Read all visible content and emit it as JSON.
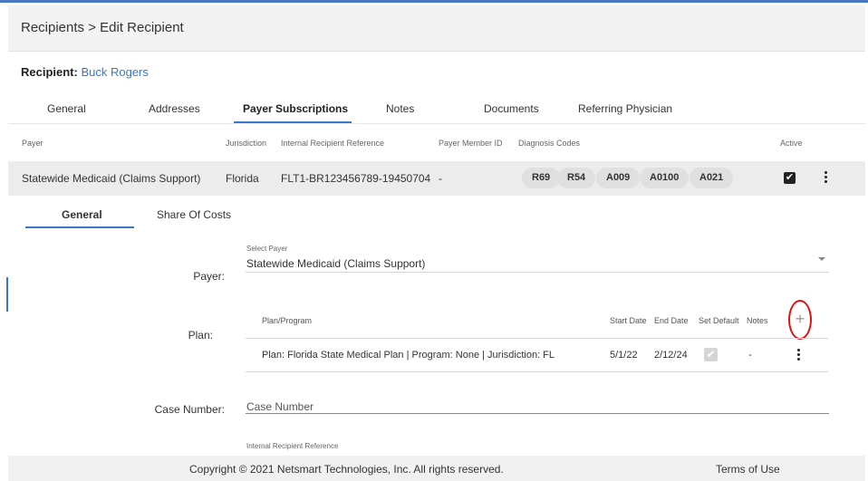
{
  "header": {
    "breadcrumb_root": "Recipients",
    "separator": ">",
    "breadcrumb_current": "Edit Recipient"
  },
  "recipient": {
    "label": "Recipient:",
    "name": "Buck Rogers"
  },
  "tabs": [
    {
      "label": "General"
    },
    {
      "label": "Addresses"
    },
    {
      "label": "Payer Subscriptions"
    },
    {
      "label": "Notes"
    },
    {
      "label": "Documents"
    },
    {
      "label": "Referring Physician"
    }
  ],
  "active_tab": "Payer Subscriptions",
  "table": {
    "columns": {
      "payer": "Payer",
      "jurisdiction": "Jurisdiction",
      "internal_ref": "Internal Recipient Reference",
      "member_id": "Payer Member ID",
      "diagnosis": "Diagnosis Codes",
      "active": "Active"
    },
    "row": {
      "payer": "Statewide Medicaid (Claims Support)",
      "jurisdiction": "Florida",
      "internal_ref": "FLT1-BR123456789-19450704",
      "member_id": "-",
      "diagnosis_codes": [
        "R69",
        "R54",
        "A009",
        "A0100",
        "A021"
      ],
      "active_check": "✔"
    }
  },
  "subtabs": [
    {
      "label": "General"
    },
    {
      "label": "Share Of Costs"
    }
  ],
  "form": {
    "payer_label": "Payer:",
    "select_payer_caption": "Select Payer",
    "payer_value": "Statewide Medicaid (Claims Support)",
    "plan_label": "Plan:",
    "plan_headers": {
      "program": "Plan/Program",
      "start": "Start Date",
      "end": "End Date",
      "set_default": "Set Default",
      "notes": "Notes"
    },
    "plan_row": {
      "program": "Plan: Florida State Medical Plan | Program: None | Jurisdiction: FL",
      "start": "5/1/22",
      "end": "2/12/24",
      "set_default_check": "✔",
      "notes": "-"
    },
    "add_symbol": "+",
    "case_label": "Case Number:",
    "case_placeholder": "Case Number",
    "internal_ref_caption": "Internal Recipient Reference"
  },
  "footer": {
    "copyright": "Copyright © 2021 Netsmart Technologies, Inc. All rights reserved.",
    "terms": "Terms of Use"
  },
  "colors": {
    "accent": "#3a78c3",
    "highlight": "#dd1111"
  }
}
